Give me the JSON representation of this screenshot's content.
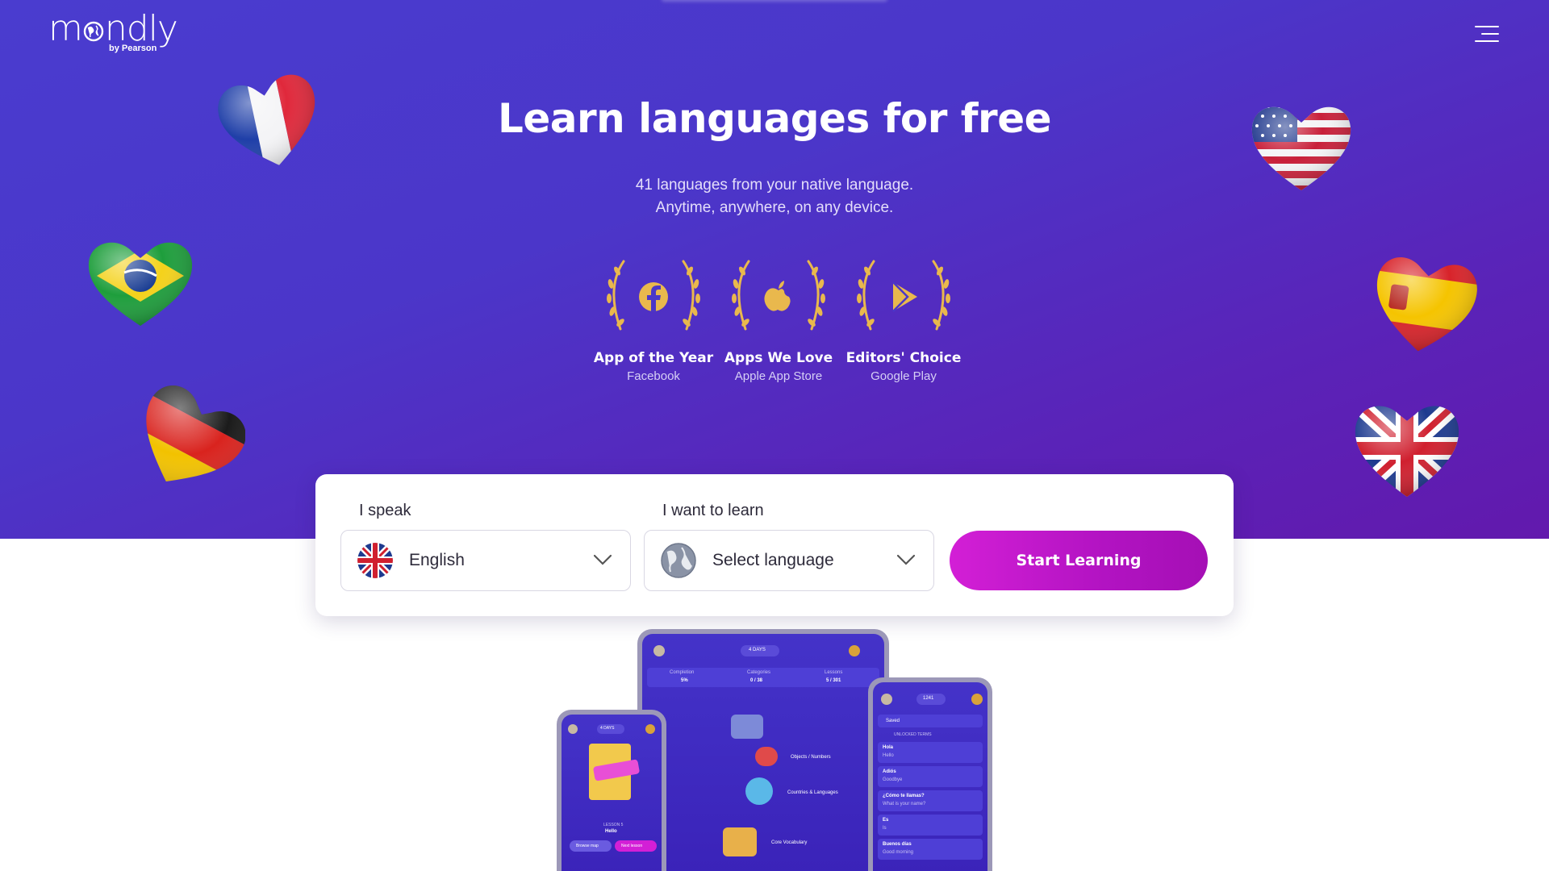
{
  "header": {
    "logo_text": "mondly",
    "logo_sub": "by Pearson",
    "menu_icon": "hamburger-menu-icon"
  },
  "hero": {
    "title": "Learn languages for free",
    "subtitle_line1": "41 languages from your native language.",
    "subtitle_line2": "Anytime, anywhere, on any device."
  },
  "awards": [
    {
      "title": "App of the Year",
      "source": "Facebook",
      "icon": "facebook-icon"
    },
    {
      "title": "Apps We Love",
      "source": "Apple App Store",
      "icon": "apple-icon"
    },
    {
      "title": "Editors' Choice",
      "source": "Google Play",
      "icon": "google-play-icon"
    }
  ],
  "flags": [
    "france-heart-balloon",
    "brazil-heart-balloon",
    "germany-heart-balloon",
    "usa-heart-balloon",
    "spain-heart-balloon",
    "uk-heart-balloon"
  ],
  "form": {
    "speak_label": "I speak",
    "speak_value": "English",
    "learn_label": "I want to learn",
    "learn_value": "Select language",
    "cta": "Start Learning"
  },
  "colors": {
    "hero_start": "#4a3ccf",
    "hero_end": "#6219ad",
    "cta_start": "#d31fd6",
    "cta_end": "#a50fb5",
    "award_gold": "#e9b84d"
  },
  "devices": {
    "tablet": {
      "streak": "4 DAYS",
      "stats": [
        {
          "label": "Completion",
          "value": "5%"
        },
        {
          "label": "Categories",
          "value": "0 / 38"
        },
        {
          "label": "Lessons",
          "value": "5 / 301"
        }
      ],
      "categories": [
        "Objects / Numbers",
        "Countries & Languages",
        "Core Vocabulary"
      ]
    },
    "phone_left": {
      "streak": "4 DAYS",
      "lesson_label": "LESSON 5",
      "lesson_title": "Hello",
      "btn_browse": "Browse map",
      "btn_next": "Next lesson"
    },
    "phone_right": {
      "streak": "1241",
      "saved": "Saved",
      "unlocked": "UNLOCKED TERMS",
      "terms": [
        {
          "term": "Hola",
          "meaning": "Hello"
        },
        {
          "term": "Adiós",
          "meaning": "Goodbye"
        },
        {
          "term": "¿Cómo te llamas?",
          "meaning": "What is your name?"
        },
        {
          "term": "Es",
          "meaning": "Is"
        },
        {
          "term": "Buenos días",
          "meaning": "Good morning"
        }
      ]
    }
  }
}
